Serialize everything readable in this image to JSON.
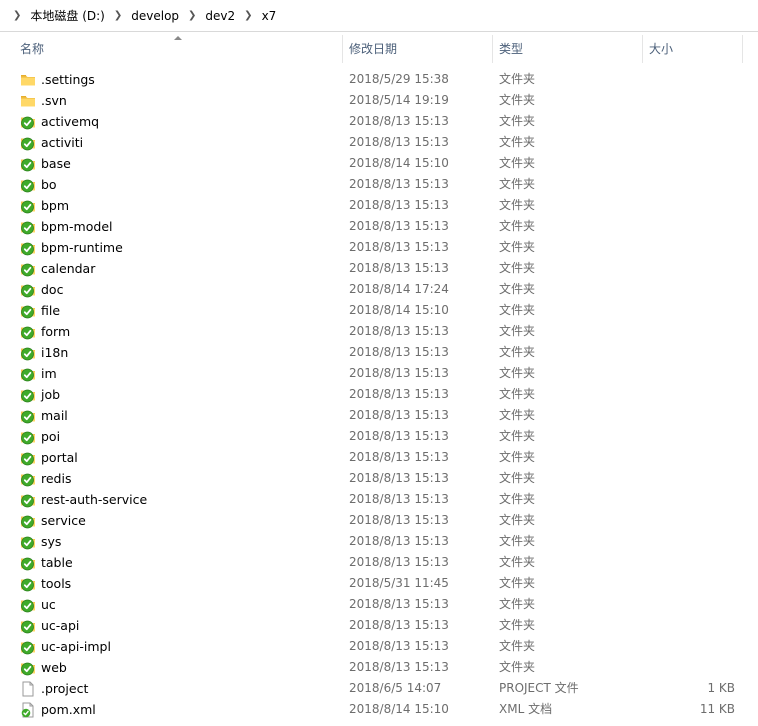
{
  "breadcrumb": [
    "本地磁盘 (D:)",
    "develop",
    "dev2",
    "x7"
  ],
  "columns": {
    "name": "名称",
    "date": "修改日期",
    "type": "类型",
    "size": "大小"
  },
  "files": [
    {
      "name": ".settings",
      "date": "2018/5/29 15:38",
      "type": "文件夹",
      "size": "",
      "icon": "folder-icon"
    },
    {
      "name": ".svn",
      "date": "2018/5/14 19:19",
      "type": "文件夹",
      "size": "",
      "icon": "folder-icon"
    },
    {
      "name": "activemq",
      "date": "2018/8/13 15:13",
      "type": "文件夹",
      "size": "",
      "icon": "svn-folder-icon"
    },
    {
      "name": "activiti",
      "date": "2018/8/13 15:13",
      "type": "文件夹",
      "size": "",
      "icon": "svn-folder-icon"
    },
    {
      "name": "base",
      "date": "2018/8/14 15:10",
      "type": "文件夹",
      "size": "",
      "icon": "svn-folder-icon"
    },
    {
      "name": "bo",
      "date": "2018/8/13 15:13",
      "type": "文件夹",
      "size": "",
      "icon": "svn-folder-icon"
    },
    {
      "name": "bpm",
      "date": "2018/8/13 15:13",
      "type": "文件夹",
      "size": "",
      "icon": "svn-folder-icon"
    },
    {
      "name": "bpm-model",
      "date": "2018/8/13 15:13",
      "type": "文件夹",
      "size": "",
      "icon": "svn-folder-icon"
    },
    {
      "name": "bpm-runtime",
      "date": "2018/8/13 15:13",
      "type": "文件夹",
      "size": "",
      "icon": "svn-folder-icon"
    },
    {
      "name": "calendar",
      "date": "2018/8/13 15:13",
      "type": "文件夹",
      "size": "",
      "icon": "svn-folder-icon"
    },
    {
      "name": "doc",
      "date": "2018/8/14 17:24",
      "type": "文件夹",
      "size": "",
      "icon": "svn-folder-icon"
    },
    {
      "name": "file",
      "date": "2018/8/14 15:10",
      "type": "文件夹",
      "size": "",
      "icon": "svn-folder-icon"
    },
    {
      "name": "form",
      "date": "2018/8/13 15:13",
      "type": "文件夹",
      "size": "",
      "icon": "svn-folder-icon"
    },
    {
      "name": "i18n",
      "date": "2018/8/13 15:13",
      "type": "文件夹",
      "size": "",
      "icon": "svn-folder-icon"
    },
    {
      "name": "im",
      "date": "2018/8/13 15:13",
      "type": "文件夹",
      "size": "",
      "icon": "svn-folder-icon"
    },
    {
      "name": "job",
      "date": "2018/8/13 15:13",
      "type": "文件夹",
      "size": "",
      "icon": "svn-folder-icon"
    },
    {
      "name": "mail",
      "date": "2018/8/13 15:13",
      "type": "文件夹",
      "size": "",
      "icon": "svn-folder-icon"
    },
    {
      "name": "poi",
      "date": "2018/8/13 15:13",
      "type": "文件夹",
      "size": "",
      "icon": "svn-folder-icon"
    },
    {
      "name": "portal",
      "date": "2018/8/13 15:13",
      "type": "文件夹",
      "size": "",
      "icon": "svn-folder-icon"
    },
    {
      "name": "redis",
      "date": "2018/8/13 15:13",
      "type": "文件夹",
      "size": "",
      "icon": "svn-folder-icon"
    },
    {
      "name": "rest-auth-service",
      "date": "2018/8/13 15:13",
      "type": "文件夹",
      "size": "",
      "icon": "svn-folder-icon"
    },
    {
      "name": "service",
      "date": "2018/8/13 15:13",
      "type": "文件夹",
      "size": "",
      "icon": "svn-folder-icon"
    },
    {
      "name": "sys",
      "date": "2018/8/13 15:13",
      "type": "文件夹",
      "size": "",
      "icon": "svn-folder-icon"
    },
    {
      "name": "table",
      "date": "2018/8/13 15:13",
      "type": "文件夹",
      "size": "",
      "icon": "svn-folder-icon"
    },
    {
      "name": "tools",
      "date": "2018/5/31 11:45",
      "type": "文件夹",
      "size": "",
      "icon": "svn-folder-icon"
    },
    {
      "name": "uc",
      "date": "2018/8/13 15:13",
      "type": "文件夹",
      "size": "",
      "icon": "svn-folder-icon"
    },
    {
      "name": "uc-api",
      "date": "2018/8/13 15:13",
      "type": "文件夹",
      "size": "",
      "icon": "svn-folder-icon"
    },
    {
      "name": "uc-api-impl",
      "date": "2018/8/13 15:13",
      "type": "文件夹",
      "size": "",
      "icon": "svn-folder-icon"
    },
    {
      "name": "web",
      "date": "2018/8/13 15:13",
      "type": "文件夹",
      "size": "",
      "icon": "svn-folder-icon"
    },
    {
      "name": ".project",
      "date": "2018/6/5 14:07",
      "type": "PROJECT 文件",
      "size": "1 KB",
      "icon": "file-icon"
    },
    {
      "name": "pom.xml",
      "date": "2018/8/14 15:10",
      "type": "XML 文档",
      "size": "11 KB",
      "icon": "svn-file-icon"
    }
  ]
}
